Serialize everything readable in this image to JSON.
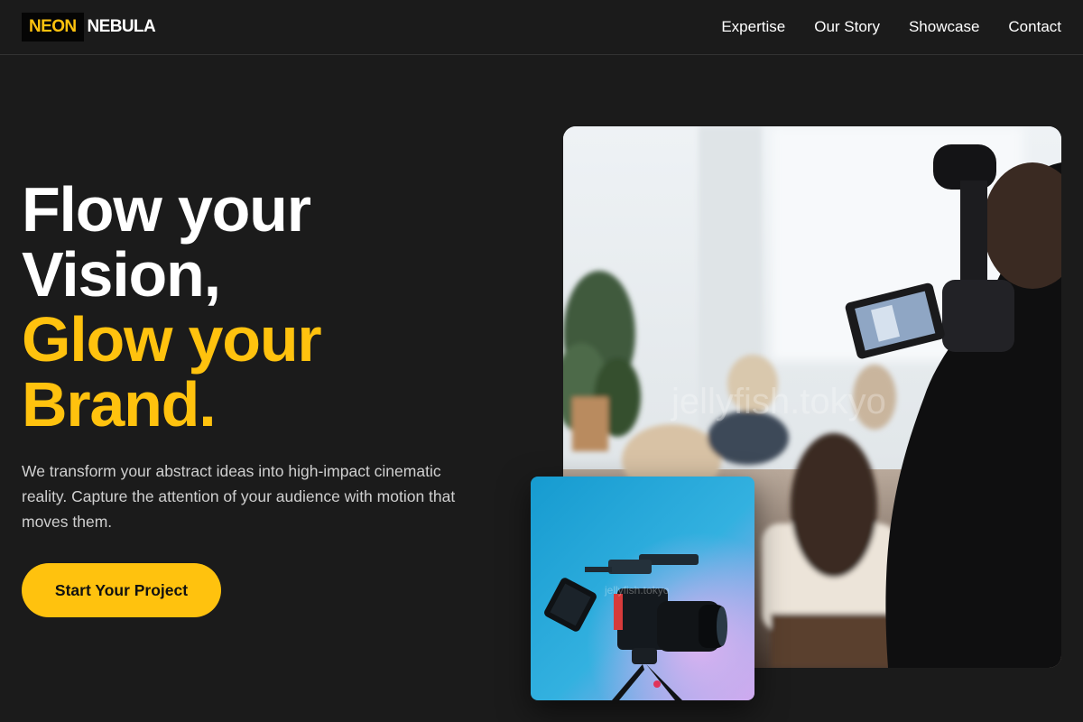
{
  "brand": {
    "part1": "NEON",
    "part2": "NEBULA",
    "accent_color": "#ffc20e"
  },
  "nav": {
    "items": [
      {
        "label": "Expertise"
      },
      {
        "label": "Our Story"
      },
      {
        "label": "Showcase"
      },
      {
        "label": "Contact"
      }
    ]
  },
  "hero": {
    "headline_line1": "Flow your",
    "headline_line2": "Vision,",
    "headline_line3": "Glow your",
    "headline_line4": "Brand.",
    "description": "We transform your abstract ideas into high-impact cinematic reality. Capture the attention of your audience with motion that moves them.",
    "cta_label": "Start Your Project"
  },
  "images": {
    "main_photo": "videographer-filming-audience",
    "main_watermark": "jellyfish.tokyo",
    "secondary_photo": "cinema-camera-rig-blue-background",
    "secondary_watermark": "jellyfish.tokyo"
  },
  "colors": {
    "background": "#1b1b1b",
    "accent": "#ffc20e",
    "text": "#ffffff",
    "muted_text": "#cfcfcf"
  }
}
